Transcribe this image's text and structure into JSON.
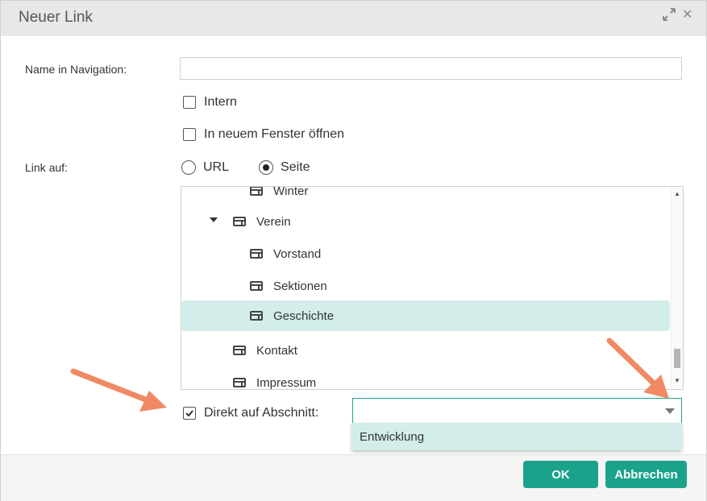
{
  "dialog": {
    "title": "Neuer Link",
    "expand_icon": "expand-icon",
    "close_icon": "close-icon"
  },
  "form": {
    "name_label": "Name in Navigation:",
    "name_value": "",
    "intern_label": "Intern",
    "intern_checked": false,
    "new_window_label": "In neuem Fenster öffnen",
    "new_window_checked": false,
    "link_label": "Link auf:",
    "radio_url": "URL",
    "radio_page": "Seite",
    "selected_radio": "Seite"
  },
  "tree": {
    "items": [
      {
        "label": "Winter",
        "level": 2
      },
      {
        "label": "Verein",
        "level": 1,
        "expanded": true
      },
      {
        "label": "Vorstand",
        "level": 2
      },
      {
        "label": "Sektionen",
        "level": 2
      },
      {
        "label": "Geschichte",
        "level": 2,
        "selected": true
      },
      {
        "label": "Kontakt",
        "level": 1
      },
      {
        "label": "Impressum",
        "level": 1,
        "icon": "hidden-page-icon"
      }
    ]
  },
  "section": {
    "label": "Direkt auf Abschnitt:",
    "checked": true,
    "value": "",
    "dropdown_options": [
      "Entwicklung"
    ]
  },
  "buttons": {
    "ok": "OK",
    "cancel": "Abbrechen"
  },
  "colors": {
    "accent": "#1aa38a",
    "selection": "#d3eeea",
    "annotation_arrow": "#f08a65"
  }
}
